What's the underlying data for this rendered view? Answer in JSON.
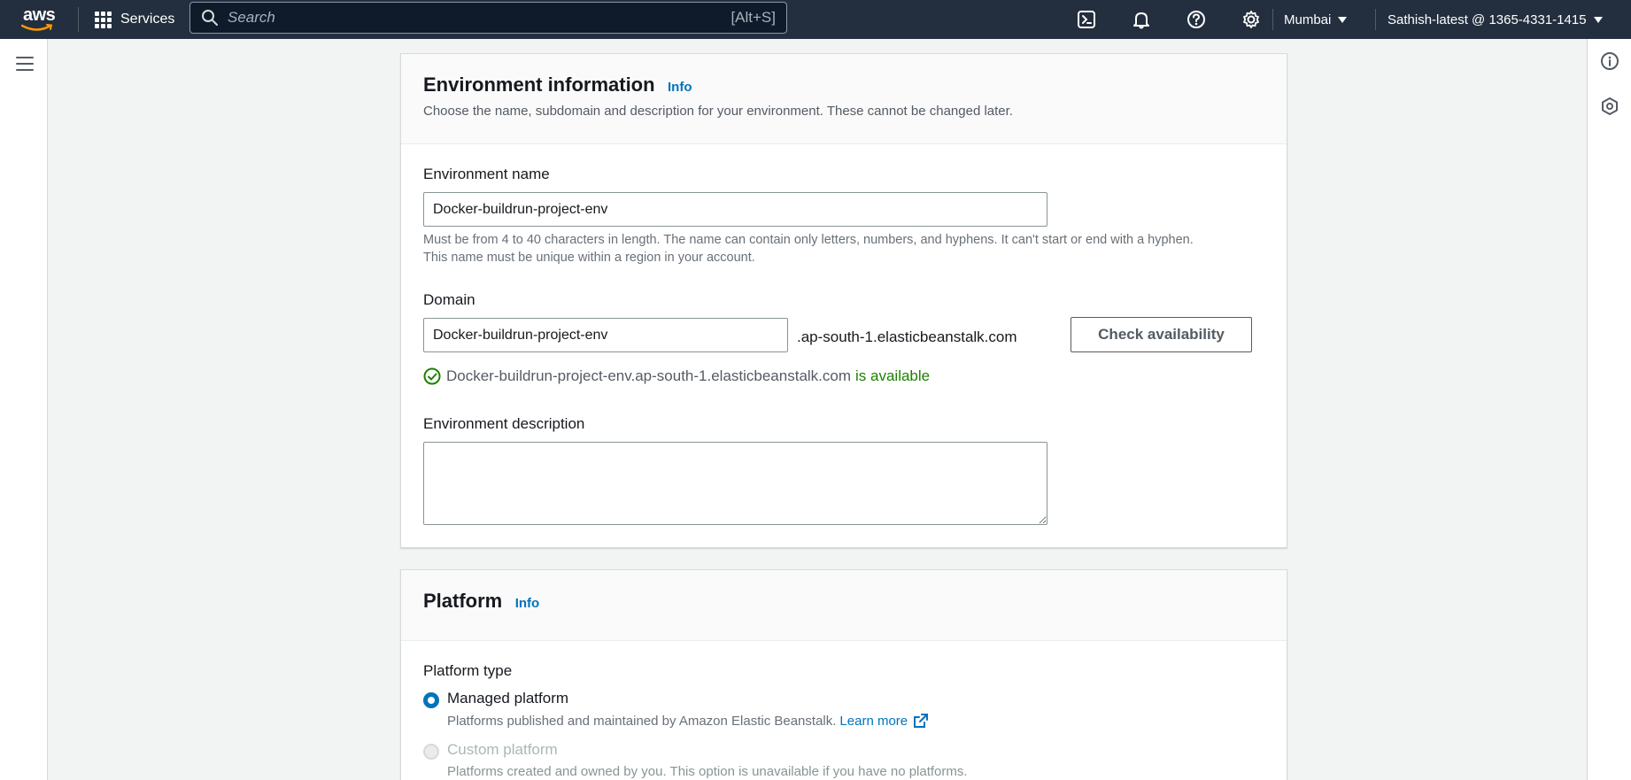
{
  "nav": {
    "logo_text": "aws",
    "services_label": "Services",
    "search_placeholder": "Search",
    "search_shortcut": "[Alt+S]",
    "region": "Mumbai",
    "account": "Sathish-latest @ 1365-4331-1415"
  },
  "env_info": {
    "title": "Environment information",
    "info": "Info",
    "description": "Choose the name, subdomain and description for your environment. These cannot be changed later.",
    "name_label": "Environment name",
    "name_value": "Docker-buildrun-project-env",
    "name_hint_1": "Must be from 4 to 40 characters in length. The name can contain only letters, numbers, and hyphens. It can't start or end with a hyphen.",
    "name_hint_2": "This name must be unique within a region in your account.",
    "domain_label": "Domain",
    "domain_value": "Docker-buildrun-project-env",
    "domain_suffix": ".ap-south-1.elasticbeanstalk.com",
    "check_button": "Check availability",
    "availability_domain": "Docker-buildrun-project-env.ap-south-1.elasticbeanstalk.com",
    "availability_status": "is available",
    "description_label": "Environment description",
    "description_value": ""
  },
  "platform": {
    "title": "Platform",
    "info": "Info",
    "type_label": "Platform type",
    "managed_label": "Managed platform",
    "managed_hint": "Platforms published and maintained by Amazon Elastic Beanstalk.",
    "learn_more": "Learn more",
    "custom_label": "Custom platform",
    "custom_hint": "Platforms created and owned by you. This option is unavailable if you have no platforms."
  },
  "colors": {
    "nav_bg": "#232f3e",
    "link": "#0073bb",
    "success": "#1d8102"
  }
}
